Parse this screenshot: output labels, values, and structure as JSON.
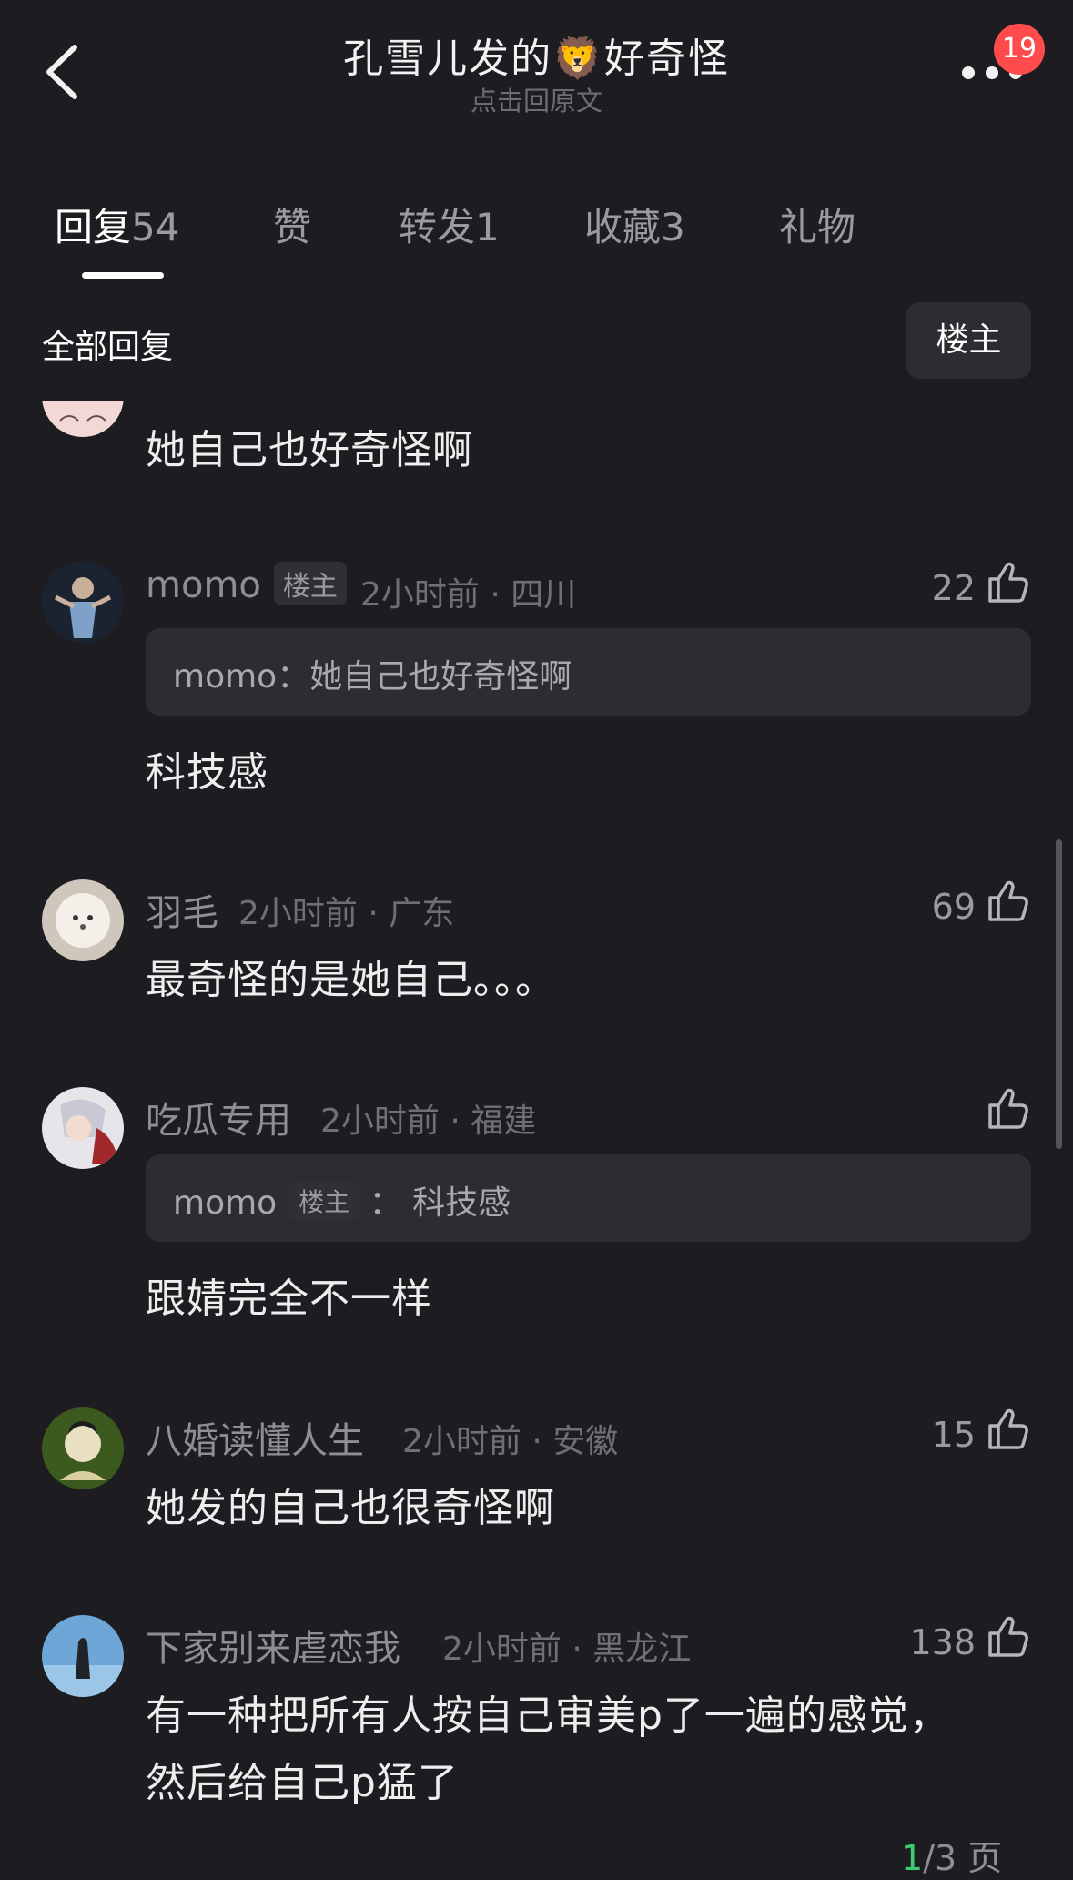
{
  "header": {
    "title": "孔雪儿发的🦁好奇怪",
    "subtitle": "点击回原文",
    "badge_count": "19",
    "icons": [
      "chevron-left-icon",
      "more-icon"
    ]
  },
  "tabs": [
    {
      "label": "回复",
      "count": "54"
    },
    {
      "label": "赞",
      "count": ""
    },
    {
      "label": "转发",
      "count": "1"
    },
    {
      "label": "收藏",
      "count": "3"
    },
    {
      "label": "礼物",
      "count": ""
    }
  ],
  "filter": {
    "label": "全部回复",
    "op_button": "楼主"
  },
  "op_tag": "楼主",
  "comments": [
    {
      "user": "",
      "meta": "",
      "likes": "",
      "text": "她自己也好奇怪啊"
    },
    {
      "user": "momo",
      "op": true,
      "meta": "2小时前 · 四川",
      "likes": "22",
      "quote": {
        "user": "momo",
        "text": "她自己也好奇怪啊"
      },
      "text": "科技感"
    },
    {
      "user": "羽毛",
      "meta": "2小时前 · 广东",
      "likes": "69",
      "text": "最奇怪的是她自己。。。"
    },
    {
      "user": "吃瓜专用",
      "meta": "2小时前 · 福建",
      "likes": "",
      "quote": {
        "user": "momo",
        "tag": "楼主",
        "text": "科技感"
      },
      "text": "跟婧完全不一样"
    },
    {
      "user": "八婚读懂人生",
      "meta": "2小时前 · 安徽",
      "likes": "15",
      "text": "她发的自己也很奇怪啊"
    },
    {
      "user": "下家别来虐恋我",
      "meta": "2小时前 · 黑龙江",
      "likes": "138",
      "text_line1": "有一种把所有人按自己审美p了一遍的感觉，",
      "text_line2": "然后给自己p猛了"
    }
  ],
  "pager": {
    "current": "1",
    "total": "/3 页"
  }
}
